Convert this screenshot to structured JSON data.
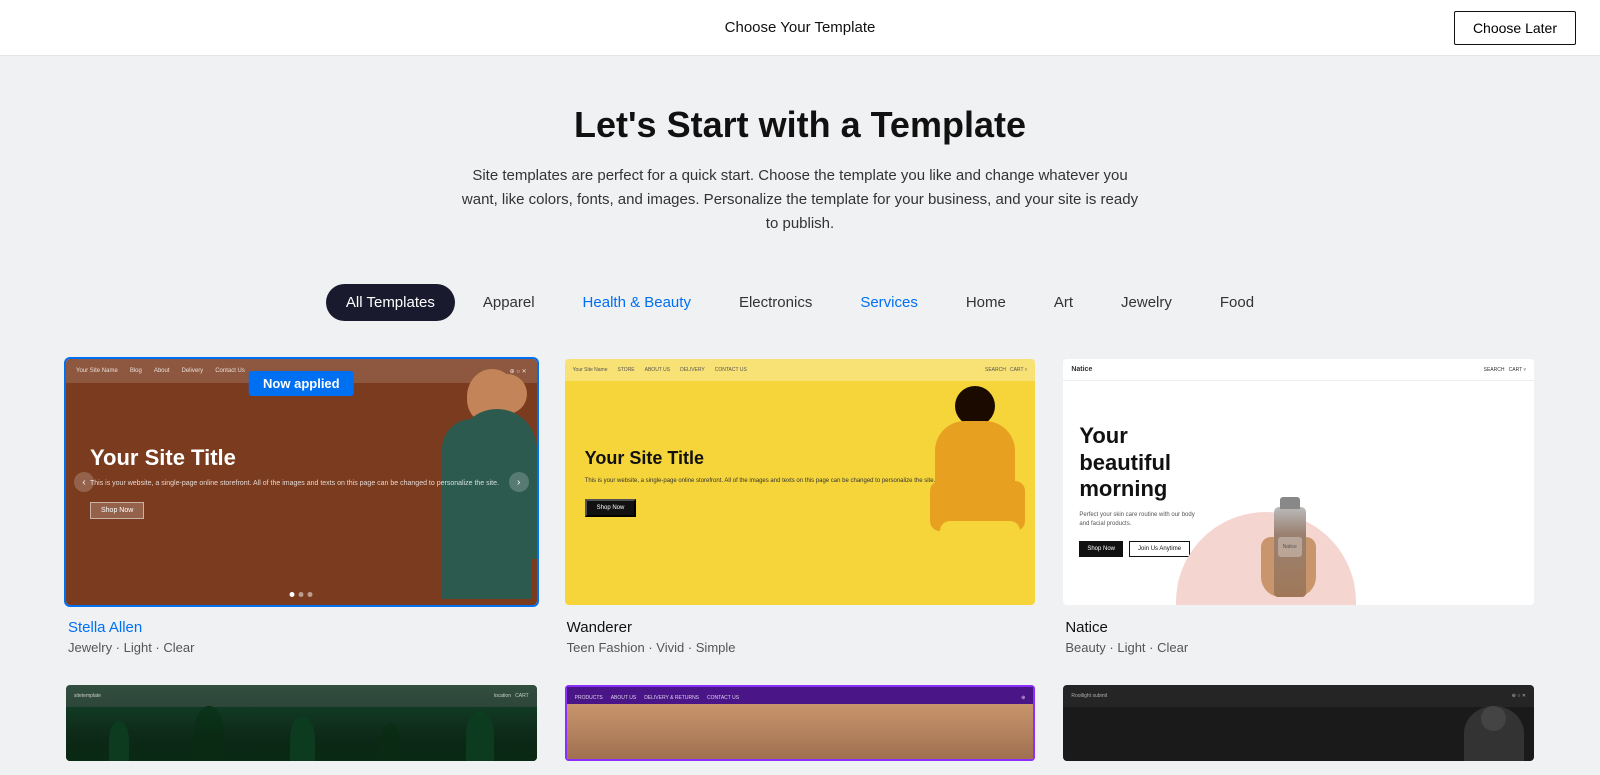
{
  "header": {
    "title": "Choose Your Template",
    "choose_later_label": "Choose Later"
  },
  "hero": {
    "heading": "Let's Start with a Template",
    "description": "Site templates are perfect for a quick start. Choose the template you like and change whatever you want, like colors, fonts, and images. Personalize the template for your business, and your site is ready to publish."
  },
  "filters": {
    "tabs": [
      {
        "id": "all",
        "label": "All Templates",
        "active": true,
        "highlight": false
      },
      {
        "id": "apparel",
        "label": "Apparel",
        "active": false,
        "highlight": false
      },
      {
        "id": "health-beauty",
        "label": "Health & Beauty",
        "active": false,
        "highlight": true
      },
      {
        "id": "electronics",
        "label": "Electronics",
        "active": false,
        "highlight": false
      },
      {
        "id": "services",
        "label": "Services",
        "active": false,
        "highlight": true
      },
      {
        "id": "home",
        "label": "Home",
        "active": false,
        "highlight": false
      },
      {
        "id": "art",
        "label": "Art",
        "active": false,
        "highlight": false
      },
      {
        "id": "jewelry",
        "label": "Jewelry",
        "active": false,
        "highlight": false
      },
      {
        "id": "food",
        "label": "Food",
        "active": false,
        "highlight": false
      }
    ]
  },
  "templates": {
    "row1": [
      {
        "id": "stella-allen",
        "name": "Stella Allen",
        "name_color": "blue",
        "tags": "Jewelry · Light · Clear",
        "now_applied": true,
        "now_applied_label": "Now applied"
      },
      {
        "id": "wanderer",
        "name": "Wanderer",
        "name_color": "dark",
        "tags": "Teen Fashion · Vivid · Simple",
        "now_applied": false
      },
      {
        "id": "natice",
        "name": "Natice",
        "name_color": "dark",
        "tags": "Beauty · Light · Clear",
        "now_applied": false
      }
    ],
    "row2": [
      {
        "id": "dark-nature",
        "name": "",
        "tags": ""
      },
      {
        "id": "purple",
        "name": "",
        "tags": ""
      },
      {
        "id": "dark-person",
        "name": "",
        "tags": ""
      }
    ]
  },
  "mock_content": {
    "site_name": "Your Site Name",
    "site_title": "Your Site Title",
    "site_desc": "This is your website, a single-page online storefront. All of the images and texts on this page can be changed to personalize the site.",
    "shop_now": "Shop Now",
    "store": "STORE",
    "about_us": "ABOUT US",
    "delivery": "DELIVERY",
    "contact_us": "CONTACT US",
    "search": "SEARCH",
    "cart": "CART",
    "natice_logo": "Natice",
    "natice_title": "Your beautiful morning",
    "natice_desc": "Perfect your skin care routine with our body and facial products.",
    "shop_now_btn": "Shop Now",
    "join_btn": "Join Us Anytime"
  }
}
